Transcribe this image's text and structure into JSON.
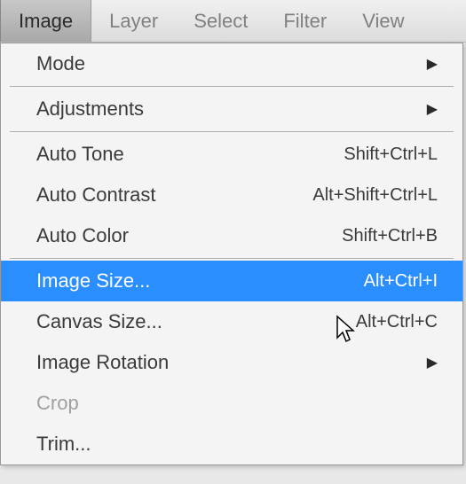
{
  "menubar": {
    "items": [
      {
        "label": "Image",
        "active": true
      },
      {
        "label": "Layer",
        "active": false
      },
      {
        "label": "Select",
        "active": false
      },
      {
        "label": "Filter",
        "active": false
      },
      {
        "label": "View",
        "active": false
      }
    ]
  },
  "dropdown": {
    "groups": [
      [
        {
          "label": "Mode",
          "shortcut": "",
          "submenu": true,
          "highlighted": false,
          "disabled": false
        }
      ],
      [
        {
          "label": "Adjustments",
          "shortcut": "",
          "submenu": true,
          "highlighted": false,
          "disabled": false
        }
      ],
      [
        {
          "label": "Auto Tone",
          "shortcut": "Shift+Ctrl+L",
          "submenu": false,
          "highlighted": false,
          "disabled": false
        },
        {
          "label": "Auto Contrast",
          "shortcut": "Alt+Shift+Ctrl+L",
          "submenu": false,
          "highlighted": false,
          "disabled": false
        },
        {
          "label": "Auto Color",
          "shortcut": "Shift+Ctrl+B",
          "submenu": false,
          "highlighted": false,
          "disabled": false
        }
      ],
      [
        {
          "label": "Image Size...",
          "shortcut": "Alt+Ctrl+I",
          "submenu": false,
          "highlighted": true,
          "disabled": false
        },
        {
          "label": "Canvas Size...",
          "shortcut": "Alt+Ctrl+C",
          "submenu": false,
          "highlighted": false,
          "disabled": false
        },
        {
          "label": "Image Rotation",
          "shortcut": "",
          "submenu": true,
          "highlighted": false,
          "disabled": false
        },
        {
          "label": "Crop",
          "shortcut": "",
          "submenu": false,
          "highlighted": false,
          "disabled": true
        },
        {
          "label": "Trim...",
          "shortcut": "",
          "submenu": false,
          "highlighted": false,
          "disabled": false
        }
      ]
    ]
  }
}
